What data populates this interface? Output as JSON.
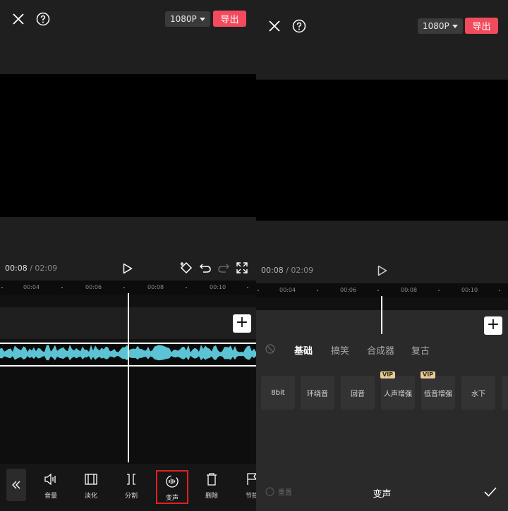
{
  "left": {
    "resolution": "1080P",
    "export_label": "导出",
    "time_current": "00:08",
    "time_sep": " / ",
    "time_total": "02:09",
    "ruler_ticks": [
      "00:04",
      "00:06",
      "00:08",
      "00:10"
    ],
    "tools": [
      {
        "label": "音量",
        "icon": "volume-icon"
      },
      {
        "label": "淡化",
        "icon": "fade-icon"
      },
      {
        "label": "分割",
        "icon": "split-icon"
      },
      {
        "label": "变声",
        "icon": "voice-change-icon",
        "selected": true
      },
      {
        "label": "删除",
        "icon": "delete-icon"
      },
      {
        "label": "节拍",
        "icon": "beat-flag-icon"
      }
    ]
  },
  "right": {
    "resolution": "1080P",
    "export_label": "导出",
    "time_current": "00:08",
    "time_sep": " / ",
    "time_total": "02:09",
    "ruler_ticks": [
      "00:04",
      "00:06",
      "00:08",
      "00:10"
    ],
    "tabs": [
      "基础",
      "搞笑",
      "合成器",
      "复古"
    ],
    "active_tab": "基础",
    "effects": [
      {
        "label": "8bit",
        "vip": false
      },
      {
        "label": "环绕音",
        "vip": false
      },
      {
        "label": "回音",
        "vip": false
      },
      {
        "label": "人声增强",
        "vip": true
      },
      {
        "label": "低音增强",
        "vip": true
      },
      {
        "label": "水下",
        "vip": false
      }
    ],
    "vip_badge": "VIP",
    "reset_label": "重置",
    "panel_title": "变声"
  },
  "colors": {
    "accent": "#f14b5d",
    "waveform": "#5bc3d3",
    "highlight_box": "#e02020",
    "vip_badge": "#e8cc9a"
  }
}
